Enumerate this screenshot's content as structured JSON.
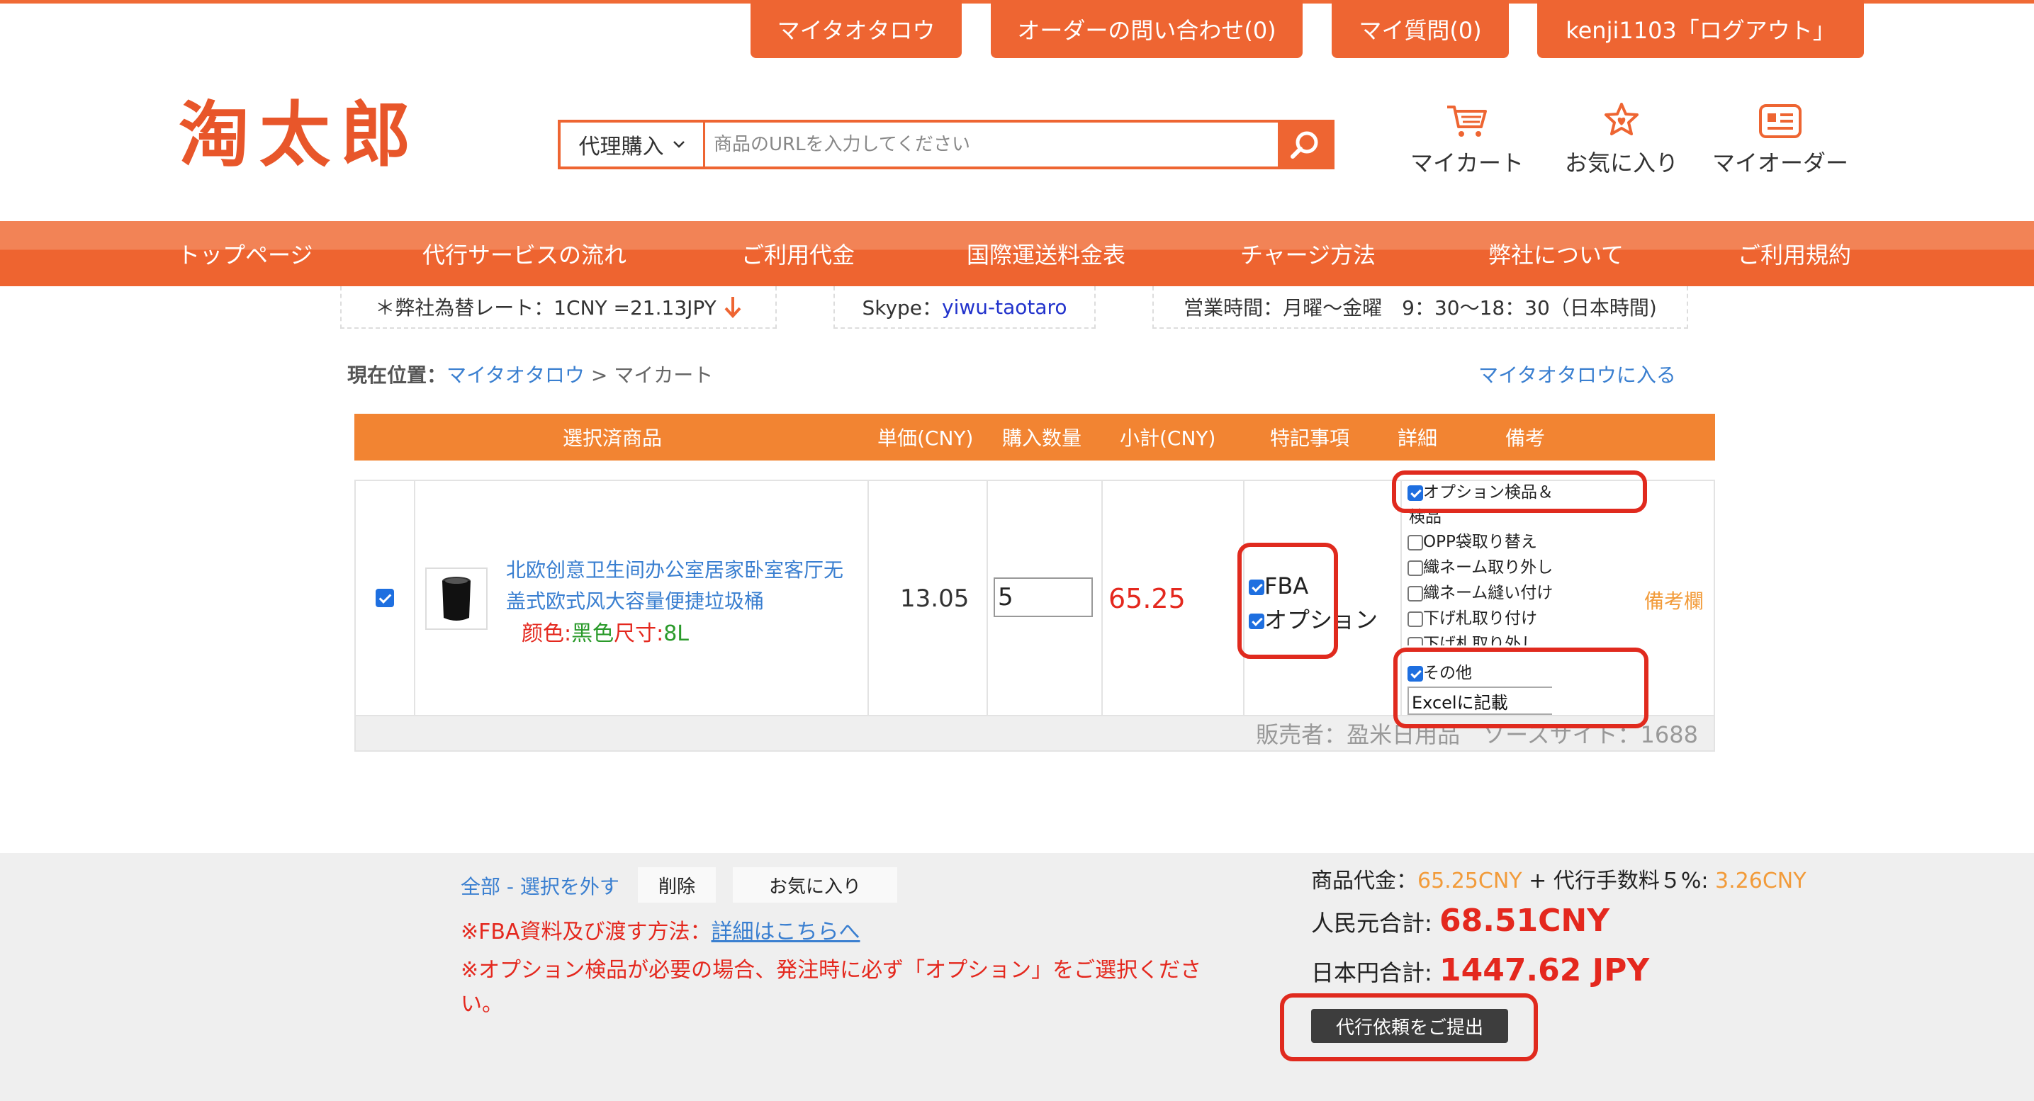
{
  "top_buttons": [
    "マイタオタロウ",
    "オーダーの問い合わせ(0)",
    "マイ質問(0)",
    "kenji1103「ログアウト」"
  ],
  "logo": "淘太郎",
  "search": {
    "select": "代理購入",
    "placeholder": "商品のURLを入力してください",
    "icon": "search-icon"
  },
  "header_icons": {
    "cart": "マイカート",
    "favorites": "お気に入り",
    "orders": "マイオーダー"
  },
  "nav": [
    "トップページ",
    "代行サービスの流れ",
    "ご利用代金",
    "国際運送料金表",
    "チャージ方法",
    "弊社について",
    "ご利用規約"
  ],
  "info": {
    "rate": "＊弊社為替レート：1CNY =21.13JPY",
    "skype_label": "Skype：",
    "skype_id": "yiwu-taotaro",
    "hours": "営業時間：月曜〜金曜　9：30〜18：30（日本時間)"
  },
  "breadcrumb": {
    "label": "現在位置：",
    "home": "マイタオタロウ",
    "sep": ">",
    "current": "マイカート",
    "enter": "マイタオタロウに入る"
  },
  "table_headers": [
    "選択済商品",
    "単価(CNY)",
    "購入数量",
    "小計(CNY)",
    "特記事項",
    "詳細",
    "備考"
  ],
  "item": {
    "checked": true,
    "title_line1": "北欧创意卫生间办公室居家卧室客厅无",
    "title_line2": "盖式欧式风大容量便捷垃圾桶",
    "color_label": "颜色:",
    "color_value": "黑色",
    "size_label": "尺寸:",
    "size_value": "8L",
    "price": "13.05",
    "qty": "5",
    "subtotal": "65.25",
    "special": [
      {
        "label": "FBA",
        "checked": true
      },
      {
        "label": "オプション",
        "checked": true
      }
    ],
    "details": {
      "main": {
        "label": "オプション検品＆アパレル",
        "checked": true
      },
      "sub_label": "検品",
      "options": [
        {
          "label": "OPP袋取り替え",
          "checked": false
        },
        {
          "label": "織ネーム取り外し",
          "checked": false
        },
        {
          "label": "織ネーム縫い付け",
          "checked": false
        },
        {
          "label": "下げ札取り付け",
          "checked": false
        },
        {
          "label": "下げ札取り外し",
          "checked": false
        }
      ],
      "other": {
        "label": "その他",
        "checked": true
      },
      "other_value": "Excelに記載"
    },
    "note": "備考欄",
    "seller": "販売者：盈米日用品　ソースサイト：1688"
  },
  "footer": {
    "select_all": "全部 - 選択を外す",
    "delete": "削除",
    "favorite": "お気に入り",
    "fba_note": "※FBA資料及び渡す方法：",
    "fba_link": "詳細はこちらへ",
    "option_note_1": "※オプション検品が必要の場合、発注時に必ず「オプション」をご選択くださ",
    "option_note_2": "い。",
    "goods_label": "商品代金：",
    "goods_value": "65.25CNY",
    "plus": "+",
    "fee_label": "代行手数料５%:",
    "fee_value": "3.26CNY",
    "cny_label": "人民元合計:",
    "cny_total": "68.51CNY",
    "jpy_label": "日本円合計:",
    "jpy_total": "1447.62 JPY",
    "submit": "代行依頼をご提出"
  }
}
